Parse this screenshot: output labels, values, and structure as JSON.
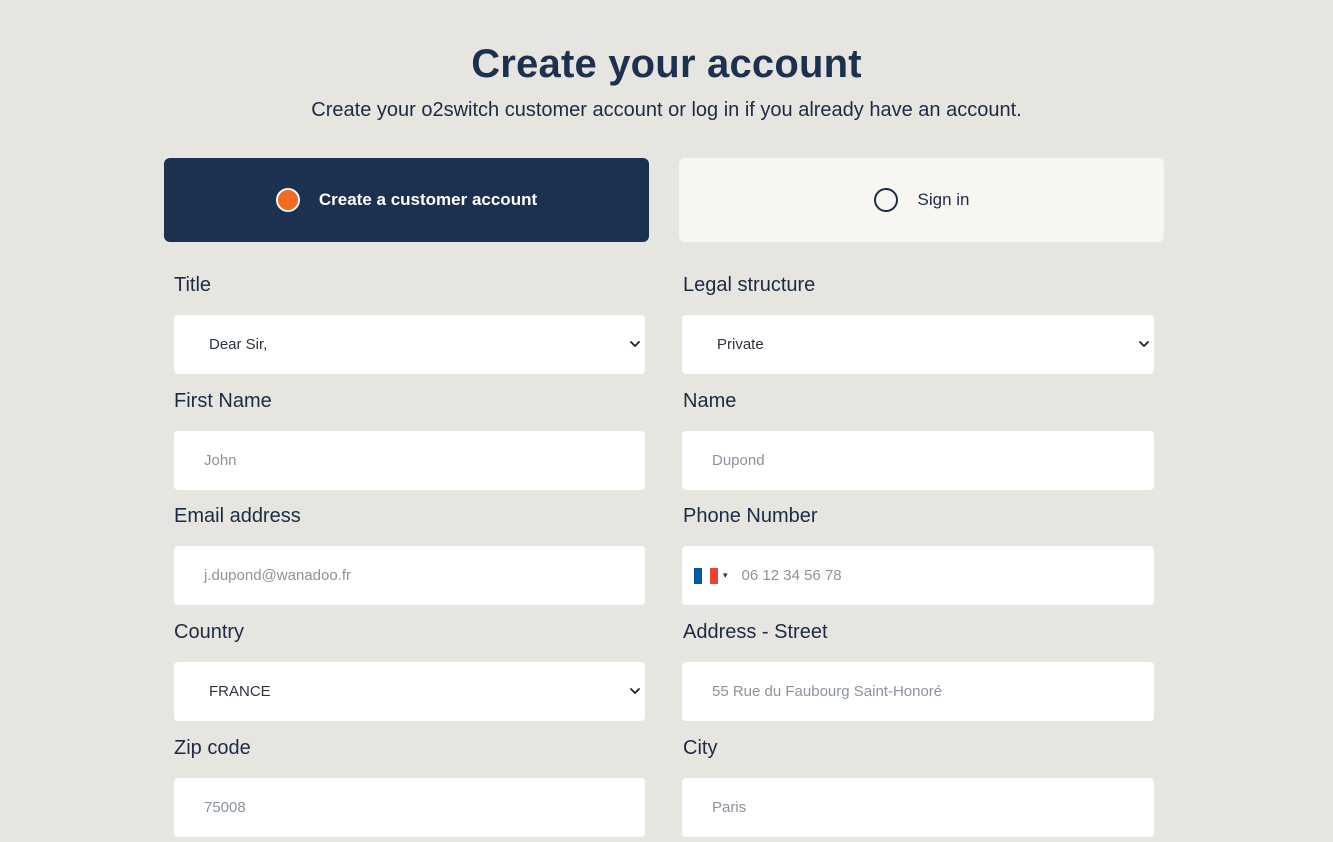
{
  "header": {
    "title": "Create your account",
    "subtitle": "Create your o2switch customer account or log in if you already have an account."
  },
  "tabs": {
    "create": "Create a customer account",
    "signin": "Sign in"
  },
  "form": {
    "title": {
      "label": "Title",
      "value": "Dear Sir,"
    },
    "legal_structure": {
      "label": "Legal structure",
      "value": "Private"
    },
    "first_name": {
      "label": "First Name",
      "placeholder": "John"
    },
    "name": {
      "label": "Name",
      "placeholder": "Dupond"
    },
    "email": {
      "label": "Email address",
      "placeholder": "j.dupond@wanadoo.fr"
    },
    "phone": {
      "label": "Phone Number",
      "placeholder": "06 12 34 56 78",
      "country_flag": "flag-france-icon",
      "arrow": "▾"
    },
    "country": {
      "label": "Country",
      "value": "FRANCE"
    },
    "street": {
      "label": "Address - Street",
      "placeholder": "55 Rue du Faubourg Saint-Honoré"
    },
    "zip": {
      "label": "Zip code",
      "placeholder": "75008"
    },
    "city": {
      "label": "City",
      "placeholder": "Paris"
    }
  },
  "colors": {
    "background": "#e7e5e0",
    "primary": "#1c314f",
    "accent": "#f26a22",
    "tab_inactive": "#f8f6f1",
    "flag_blue": "#0055a4",
    "flag_white": "#ffffff",
    "flag_red": "#ef4135"
  }
}
